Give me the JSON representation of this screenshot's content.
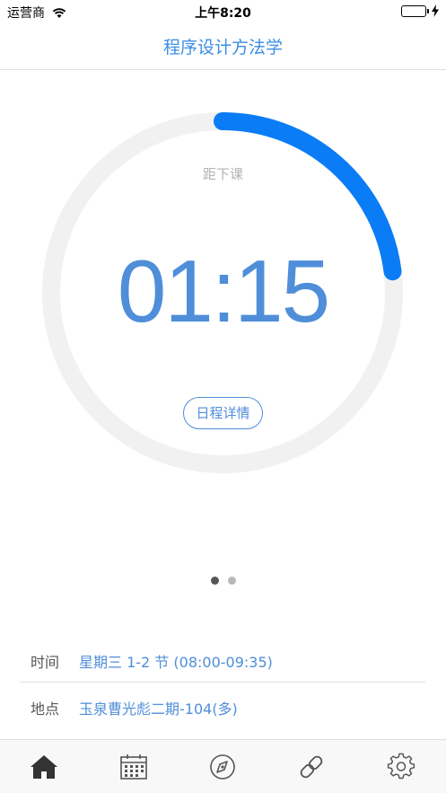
{
  "status_bar": {
    "carrier": "运营商",
    "time": "上午8:20"
  },
  "nav": {
    "title": "程序设计方法学"
  },
  "countdown": {
    "label": "距下课",
    "time": "01:15",
    "progress_fraction": 0.23,
    "track_color": "#f1f1f1",
    "progress_color": "#0a7cf5",
    "schedule_button": "日程详情"
  },
  "pager": {
    "total": 2,
    "current": 1
  },
  "details": {
    "time_label": "时间",
    "time_value": "星期三 1-2 节 (08:00-09:35)",
    "place_label": "地点",
    "place_value": "玉泉曹光彪二期-104(多)"
  },
  "tabs": [
    {
      "icon": "home-icon",
      "active": true
    },
    {
      "icon": "calendar-icon",
      "active": false
    },
    {
      "icon": "compass-icon",
      "active": false
    },
    {
      "icon": "link-icon",
      "active": false
    },
    {
      "icon": "gear-icon",
      "active": false
    }
  ]
}
